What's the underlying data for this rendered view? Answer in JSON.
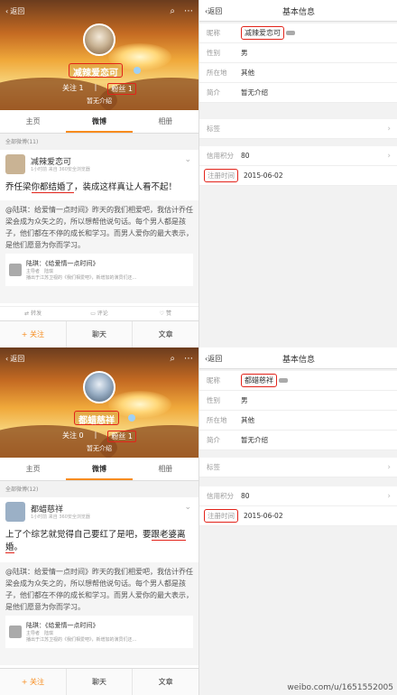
{
  "top": {
    "profile": {
      "back": "返回",
      "nickname": "减辣爱恋可",
      "follow_label": "关注",
      "follow_count": "1",
      "fans_label": "粉丝",
      "fans_count": "1",
      "intro": "暂无介绍",
      "tabs": [
        "主页",
        "微博",
        "相册"
      ],
      "active_tab": 1,
      "all_weibo": "全部微博(11)",
      "post_name": "减辣爱恋可",
      "post_meta": "1小时前 来自 360安全浏览器",
      "post_text_a": "乔任梁",
      "post_text_b": "你都结婚了",
      "post_text_c": "，装成这样真让人看不起！",
      "repost_text": "@陆琪：给爱情一点时间》昨天的我们相爱吧，我估计乔任梁会成为众矢之的，所以想帮他说句话。每个男人都是孩子，他们都在不停的成长和学习。而男人爱你的最大表示，是他们愿意为你而学习。",
      "card_title": "陆琪：《给爱情一点时间》",
      "card_sub": "主导者　陆琪",
      "card_desc": "播出于江苏卫视的《我们相爱吧》，新增加的演员们还…",
      "actions": [
        "转发",
        "评论",
        "赞"
      ],
      "bottom": [
        "+ 关注",
        "聊天",
        "文章"
      ]
    },
    "info": {
      "back": "返回",
      "title": "基本信息",
      "rows": [
        {
          "k": "昵称",
          "v": "减辣爱恋可"
        },
        {
          "k": "性别",
          "v": "男"
        },
        {
          "k": "所在地",
          "v": "其他"
        },
        {
          "k": "简介",
          "v": "暂无介绍"
        }
      ],
      "badge": "简单",
      "rows2": [
        {
          "k": "信用积分",
          "v": "80"
        },
        {
          "k": "注册时间",
          "v": "2015-06-02"
        }
      ]
    }
  },
  "bottom": {
    "profile": {
      "back": "返回",
      "nickname": "都蜡慈祥",
      "follow_label": "关注",
      "follow_count": "0",
      "fans_label": "粉丝",
      "fans_count": "1",
      "intro": "暂无介绍",
      "tabs": [
        "主页",
        "微博",
        "相册"
      ],
      "active_tab": 1,
      "all_weibo": "全部微博(12)",
      "post_name": "都蜡慈祥",
      "post_meta": "1小时前 来自 360安全浏览器",
      "post_text_a": "上了个综艺就觉得自己要红了是吧，要",
      "post_text_b": "跟老婆离婚",
      "post_text_c": "。",
      "repost_text": "@陆琪：给爱情一点时间》昨天的我们相爱吧，我估计乔任梁会成为众矢之的，所以想帮他说句话。每个男人都是孩子，他们都在不停的成长和学习。而男人爱你的最大表示，是他们愿意为你而学习。",
      "card_title": "陆琪：《给爱情一点时间》",
      "card_sub": "主导者　陆琪",
      "card_desc": "播出于江苏卫视的《我们相爱吧》，新增加的演员们还…",
      "bottom": [
        "+ 关注",
        "聊天",
        "文章"
      ]
    },
    "info": {
      "back": "返回",
      "title": "基本信息",
      "rows": [
        {
          "k": "昵称",
          "v": "都蜡慈祥"
        },
        {
          "k": "性别",
          "v": "男"
        },
        {
          "k": "所在地",
          "v": "其他"
        },
        {
          "k": "简介",
          "v": "暂无介绍"
        }
      ],
      "rows2": [
        {
          "k": "信用积分",
          "v": "80"
        },
        {
          "k": "注册时间",
          "v": "2015-06-02"
        }
      ]
    }
  },
  "watermark": "weibo.com/u/1651552005"
}
